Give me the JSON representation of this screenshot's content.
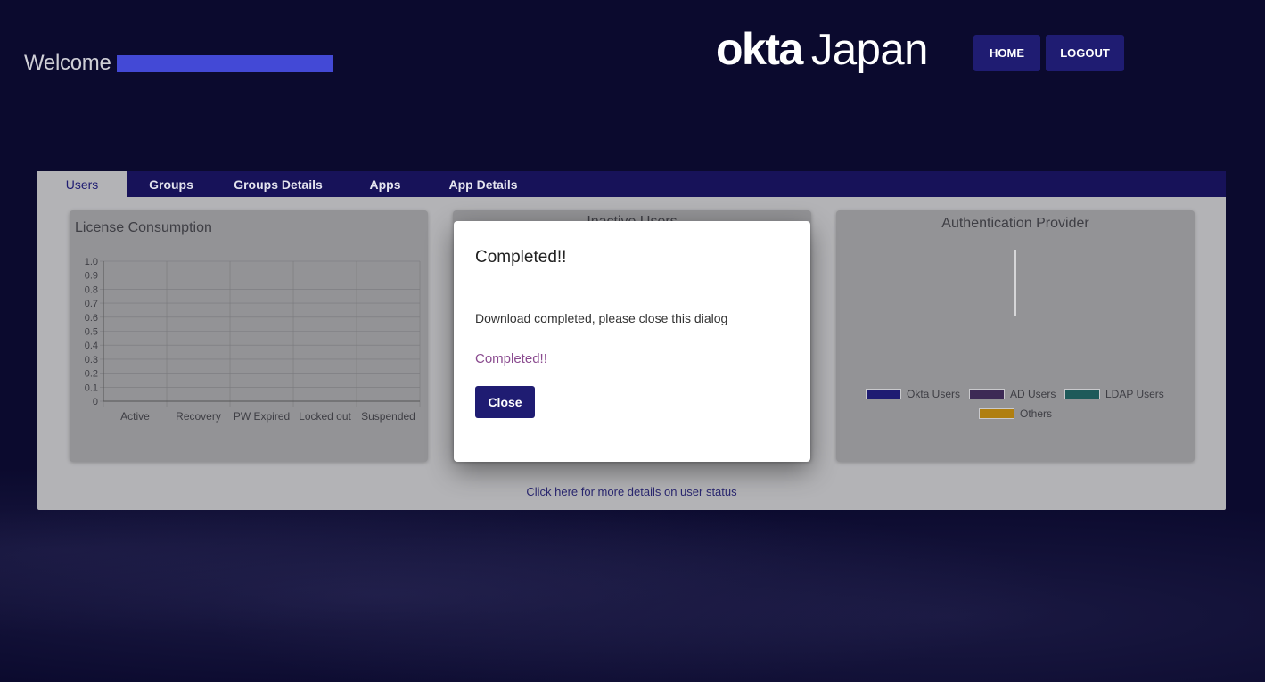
{
  "header": {
    "welcome": "Welcome",
    "logo_okta": "okta",
    "logo_japan": "Japan",
    "home_label": "HOME",
    "logout_label": "LOGOUT"
  },
  "tabs": [
    {
      "label": "Users",
      "active": true
    },
    {
      "label": "Groups",
      "active": false
    },
    {
      "label": "Groups Details",
      "active": false
    },
    {
      "label": "Apps",
      "active": false
    },
    {
      "label": "App Details",
      "active": false
    }
  ],
  "cards": {
    "license": {
      "title": "License Consumption"
    },
    "inactive": {
      "title": "Inactive Users"
    },
    "auth": {
      "title": "Authentication Provider"
    }
  },
  "link_text": "Click here for more details on user status",
  "chart_data": [
    {
      "type": "bar",
      "title": "License Consumption",
      "categories": [
        "Active",
        "Recovery",
        "PW Expired",
        "Locked out",
        "Suspended"
      ],
      "values": [
        0,
        0,
        0,
        0,
        0
      ],
      "ylim": [
        0,
        1.0
      ],
      "yticks": [
        "0",
        "0.1",
        "0.2",
        "0.3",
        "0.4",
        "0.5",
        "0.6",
        "0.7",
        "0.8",
        "0.9",
        "1.0"
      ],
      "grid": true
    },
    {
      "type": "pie",
      "title": "Authentication Provider",
      "categories": [
        "Okta Users",
        "AD Users",
        "LDAP Users",
        "Others"
      ],
      "values": [
        0,
        0,
        0,
        0
      ],
      "colors": [
        "#1f1c72",
        "#3d2a55",
        "#1e5a5a",
        "#b07f10"
      ],
      "legend": "bottom"
    }
  ],
  "modal": {
    "title": "Completed!!",
    "body": "Download completed, please close this dialog",
    "status": "Completed!!",
    "close_label": "Close"
  }
}
